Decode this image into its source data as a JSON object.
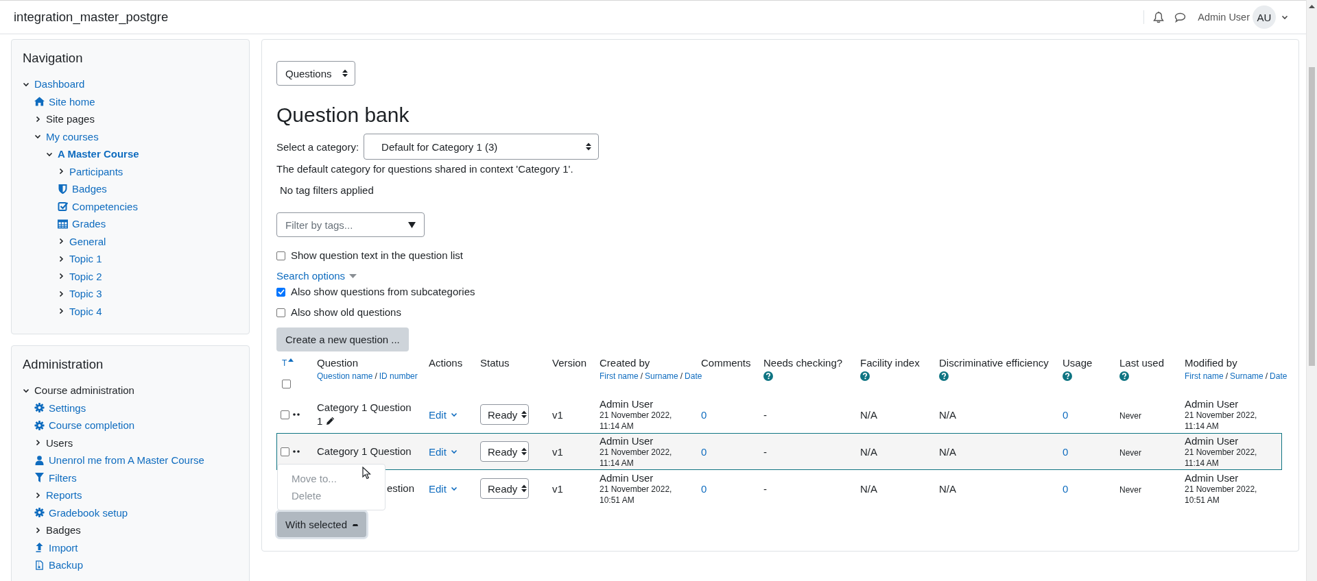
{
  "header": {
    "site_name": "integration_master_postgre",
    "user_name": "Admin User",
    "avatar_initials": "AU"
  },
  "navigation": {
    "title": "Navigation",
    "items": [
      {
        "label": "Dashboard",
        "link": true,
        "expanded": true,
        "children": [
          {
            "label": "Site home",
            "link": true
          },
          {
            "label": "Site pages",
            "link": false,
            "expanded": false
          },
          {
            "label": "My courses",
            "link": true,
            "expanded": true,
            "children": [
              {
                "label": "A Master Course",
                "link": true,
                "active": true,
                "expanded": true,
                "children": [
                  {
                    "label": "Participants",
                    "link": true,
                    "expanded": false
                  },
                  {
                    "label": "Badges",
                    "link": true
                  },
                  {
                    "label": "Competencies",
                    "link": true
                  },
                  {
                    "label": "Grades",
                    "link": true
                  },
                  {
                    "label": "General",
                    "link": true,
                    "expanded": false
                  },
                  {
                    "label": "Topic 1",
                    "link": true,
                    "expanded": false
                  },
                  {
                    "label": "Topic 2",
                    "link": true,
                    "expanded": false
                  },
                  {
                    "label": "Topic 3",
                    "link": true,
                    "expanded": false
                  },
                  {
                    "label": "Topic 4",
                    "link": true,
                    "expanded": false
                  }
                ]
              }
            ]
          }
        ]
      }
    ]
  },
  "administration": {
    "title": "Administration",
    "items": [
      {
        "label": "Course administration",
        "link": false,
        "expanded": true,
        "children": [
          {
            "label": "Settings",
            "link": true
          },
          {
            "label": "Course completion",
            "link": true
          },
          {
            "label": "Users",
            "link": false,
            "expanded": false
          },
          {
            "label": "Unenrol me from A Master Course",
            "link": true
          },
          {
            "label": "Filters",
            "link": true
          },
          {
            "label": "Reports",
            "link": true,
            "expanded": false
          },
          {
            "label": "Gradebook setup",
            "link": true
          },
          {
            "label": "Badges",
            "link": false,
            "expanded": false
          },
          {
            "label": "Import",
            "link": true
          },
          {
            "label": "Backup",
            "link": true
          }
        ]
      }
    ]
  },
  "main": {
    "page_select": "Questions",
    "heading": "Question bank",
    "category_label": "Select a category:",
    "category_select": "Default for Category 1 (3)",
    "category_info": "The default category for questions shared in context 'Category 1'.",
    "tag_status": "No tag filters applied",
    "tag_filter": {
      "placeholder": "Filter by tags..."
    },
    "show_text_option": {
      "label": "Show question text in the question list",
      "checked": false
    },
    "search_options": "Search options",
    "search_checks": [
      {
        "label": "Also show questions from subcategories",
        "checked": true
      },
      {
        "label": "Also show old questions",
        "checked": false
      }
    ],
    "create_button": "Create a new question ...",
    "table": {
      "select_all": {
        "checked": false
      },
      "columns": [
        {
          "title": "T",
          "sorted": true
        },
        {
          "title": "Question",
          "separator": "/",
          "sort_links": [
            "Question name",
            "ID number"
          ]
        },
        {
          "title": "Actions"
        },
        {
          "title": "Status"
        },
        {
          "title": "Version"
        },
        {
          "title": "Created by",
          "separator": "/",
          "sort_links": [
            "First name",
            "Surname",
            "Date"
          ]
        },
        {
          "title": "Comments"
        },
        {
          "title": "Needs checking?",
          "help": true
        },
        {
          "title": "Facility index",
          "help": true
        },
        {
          "title": "Discriminative efficiency",
          "help": true
        },
        {
          "title": "Usage",
          "help": true
        },
        {
          "title": "Last used",
          "help": true
        },
        {
          "title": "Modified by",
          "separator": "/",
          "sort_links": [
            "First name",
            "Surname",
            "Date"
          ]
        }
      ],
      "rows": [
        {
          "checked": false,
          "highlighted": false,
          "question": "Category 1 Question 1",
          "edit_icon": true,
          "covered": false,
          "action": "Edit",
          "status": "Ready",
          "version": "v1",
          "created_by": "Admin User",
          "created_date": "21 November 2022, 11:14 AM",
          "comments": "0",
          "needs_checking": "-",
          "facility": "N/A",
          "discrimination": "N/A",
          "usage": "0",
          "last_used": "Never",
          "modified_by": "Admin User",
          "modified_date": "21 November 2022, 11:14 AM"
        },
        {
          "checked": false,
          "highlighted": true,
          "question": "Category 1 Question",
          "edit_icon": false,
          "covered": false,
          "action": "Edit",
          "status": "Ready",
          "version": "v1",
          "created_by": "Admin User",
          "created_date": "21 November 2022, 11:14 AM",
          "comments": "0",
          "needs_checking": "-",
          "facility": "N/A",
          "discrimination": "N/A",
          "usage": "0",
          "last_used": "Never",
          "modified_by": "Admin User",
          "modified_date": "21 November 2022, 11:14 AM"
        },
        {
          "highlighted": false,
          "question": "estion",
          "edit_icon": false,
          "covered": true,
          "action": "Edit",
          "status": "Ready",
          "version": "v1",
          "created_by": "Admin User",
          "created_date": "21 November 2022, 10:51 AM",
          "comments": "0",
          "needs_checking": "-",
          "facility": "N/A",
          "discrimination": "N/A",
          "usage": "0",
          "last_used": "Never",
          "modified_by": "Admin User",
          "modified_date": "21 November 2022, 10:51 AM"
        }
      ]
    },
    "bulk_menu": {
      "button": "With selected",
      "expanded": true,
      "items": [
        {
          "label": "Move to...",
          "disabled": true
        },
        {
          "label": "Delete",
          "disabled": true
        }
      ]
    }
  }
}
